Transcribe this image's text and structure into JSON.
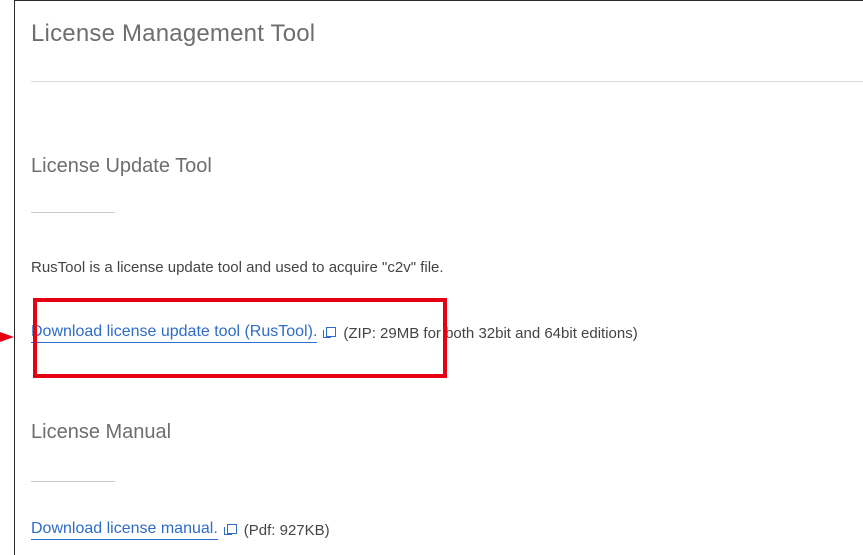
{
  "page": {
    "title": "License Management Tool"
  },
  "sections": [
    {
      "heading": "License Update Tool",
      "description": "RusTool is a license update tool and used to acquire \"c2v\" file.",
      "link_label": "Download license update tool (RusTool).",
      "link_icon": "external-link-icon",
      "note": "(ZIP: 29MB for both 32bit and 64bit editions)"
    },
    {
      "heading": "License Manual",
      "link_label": "Download license manual.",
      "link_icon": "external-link-icon",
      "note": "(Pdf: 927KB)"
    }
  ],
  "annotation": {
    "highlight_color": "#e50012"
  },
  "colors": {
    "link": "#2e6cc7",
    "heading": "#6e6e6e",
    "text": "#444444"
  }
}
